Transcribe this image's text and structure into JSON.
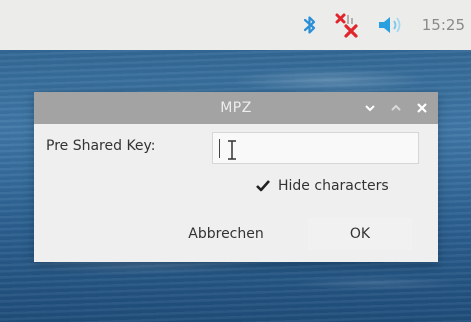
{
  "taskbar": {
    "tray": {
      "bluetooth_icon": "bluetooth-icon",
      "network_icon": "network-disconnected-icon",
      "volume_icon": "volume-icon"
    },
    "clock": "15:25"
  },
  "dialog": {
    "title": "MPZ",
    "psk_label": "Pre Shared Key:",
    "psk_value": "",
    "hide_characters_label": "Hide characters",
    "hide_characters_checked": true,
    "cancel_label": "Abbrechen",
    "ok_label": "OK"
  },
  "colors": {
    "bluetooth": "#2a8fd6",
    "network_error": "#e0252c",
    "volume": "#2aa0e0",
    "titlebar": "#a3a3a3"
  }
}
